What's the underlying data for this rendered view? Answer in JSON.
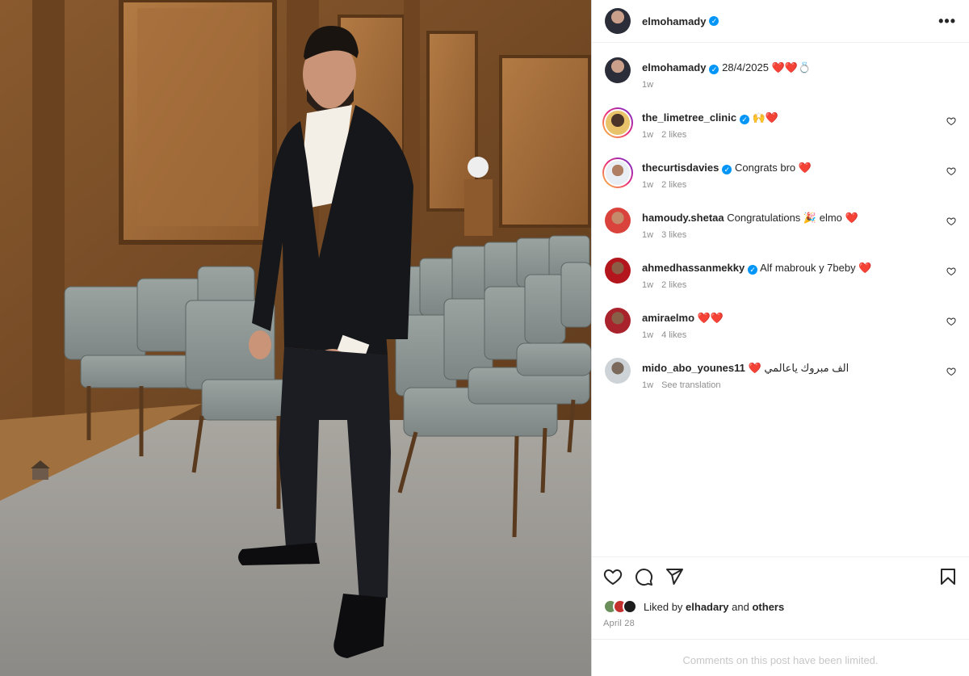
{
  "post": {
    "author": "elmohamady",
    "caption_date": "28/4/2025",
    "caption_emojis": "❤️❤️💍",
    "caption_age": "1w"
  },
  "comments": [
    {
      "user": "the_limetree_clinic",
      "verified": true,
      "text": "🙌❤️",
      "age": "1w",
      "likes": "2 likes",
      "ring": true
    },
    {
      "user": "thecurtisdavies",
      "verified": true,
      "text": "Congrats bro ❤️",
      "age": "1w",
      "likes": "2 likes",
      "ring": true
    },
    {
      "user": "hamoudy.shetaa",
      "verified": false,
      "text": "Congratulations 🎉 elmo ❤️",
      "age": "1w",
      "likes": "3 likes",
      "ring": false
    },
    {
      "user": "ahmedhassanmekky",
      "verified": true,
      "text": "Alf mabrouk y 7beby ❤️",
      "age": "1w",
      "likes": "2 likes",
      "ring": false
    },
    {
      "user": "amiraelmo",
      "verified": false,
      "text": "❤️❤️",
      "age": "1w",
      "likes": "4 likes",
      "ring": false
    },
    {
      "user": "mido_abo_younes11",
      "verified": false,
      "text": "❤️ الف مبروك ياعالمي",
      "age": "1w",
      "likes": "See translation",
      "ring": false
    }
  ],
  "likes": {
    "prefix": "Liked by",
    "user": "elhadary",
    "and": "and",
    "others": "others"
  },
  "date": "April 28",
  "limited_notice": "Comments on this post have been limited.",
  "colors": {
    "verified": "#0095f6",
    "heart": "#e0245e",
    "muted": "#8e8e8e"
  }
}
